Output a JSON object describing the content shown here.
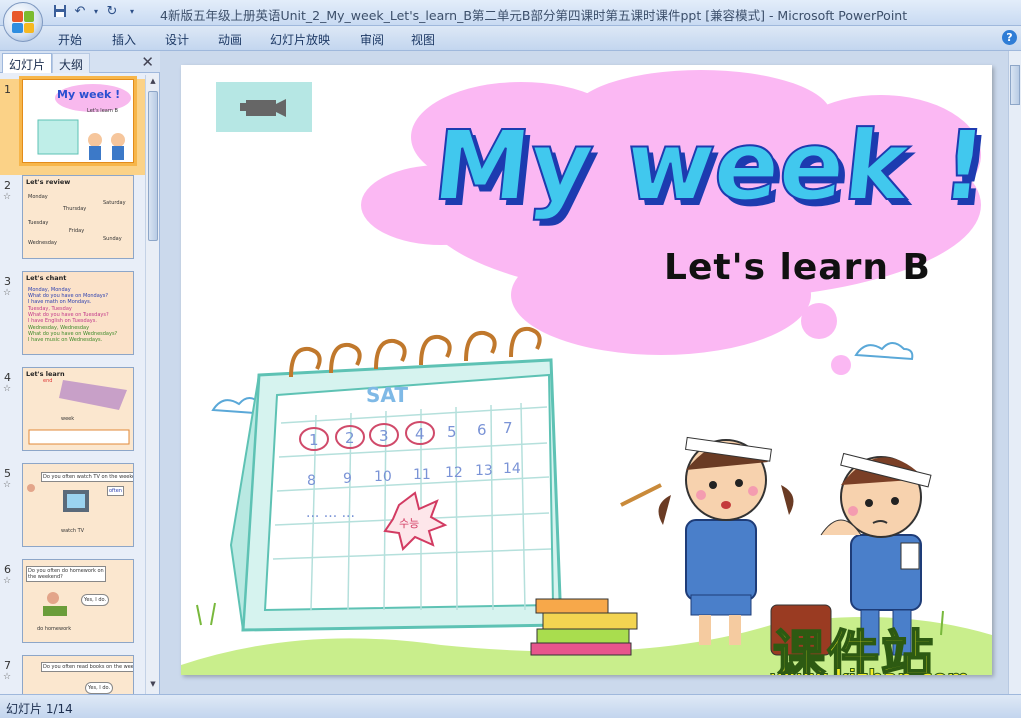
{
  "window": {
    "title": "4新版五年级上册英语Unit_2_My_week_Let's_learn_B第二单元B部分第四课时第五课时课件ppt [兼容模式] - Microsoft PowerPoint"
  },
  "ribbon": {
    "tabs": [
      "开始",
      "插入",
      "设计",
      "动画",
      "幻灯片放映",
      "审阅",
      "视图"
    ]
  },
  "panel": {
    "tab_slides": "幻灯片",
    "tab_outline": "大纲",
    "thumbnails": [
      {
        "num": "1",
        "heading": "My week !",
        "lines": [
          "Let's learn B"
        ]
      },
      {
        "num": "2",
        "heading": "Let's review",
        "lines": [
          "Monday",
          "Thursday",
          "Saturday",
          "Tuesday",
          "Friday",
          "Sunday",
          "Wednesday"
        ]
      },
      {
        "num": "3",
        "heading": "Let's chant",
        "lines": [
          "Monday, Monday",
          "What do you have on Mondays?",
          "I have math on Mondays.",
          "Tuesday, Tuesday",
          "What do you have on Tuesdays?",
          "I have English on Tuesdays.",
          "Wednesday, Wednesday",
          "What do you have on Wednesdays?",
          "I have music on Wednesdays."
        ]
      },
      {
        "num": "4",
        "heading": "Let's learn",
        "lines": [
          "end",
          "week"
        ]
      },
      {
        "num": "5",
        "heading": "",
        "lines": [
          "Do you often watch TV on the weekend?",
          "often",
          "watch TV"
        ]
      },
      {
        "num": "6",
        "heading": "",
        "lines": [
          "Do you often do homework on the weekend?",
          "Yes, I do.",
          "do homework"
        ]
      },
      {
        "num": "7",
        "heading": "",
        "lines": [
          "Do you often read books on the weekend?",
          "Yes, I do."
        ]
      }
    ]
  },
  "slide": {
    "title": "My week !",
    "subtitle": "Let's learn B",
    "calendar_header": "SAT",
    "calendar_row1": [
      "1",
      "2",
      "3",
      "4",
      "5",
      "6",
      "7"
    ],
    "calendar_row2": [
      "8",
      "9",
      "10",
      "11",
      "12",
      "13",
      "14"
    ],
    "calendar_dots": "... ... ...",
    "calendar_stamp": "수능",
    "watermark_cn": "课件站",
    "watermark_url": "www.kjzhan.com"
  },
  "status": {
    "slide_counter": "幻灯片 1/14"
  }
}
